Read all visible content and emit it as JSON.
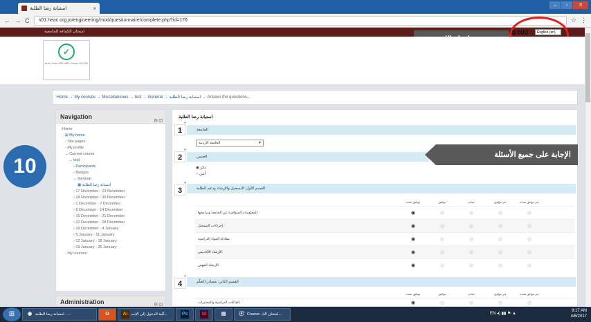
{
  "browser": {
    "tab_title": "استبانة رضا الطلبة",
    "tab_close": "×",
    "url": "n01.heac.org.jo/engineering/mod/questionnaire/complete.php?id=176",
    "nav_back": "←",
    "nav_forward": "→",
    "reload": "C",
    "star": "☆",
    "menu": "⋮"
  },
  "site": {
    "header_link": "امتحان الكفاءة الجامعية",
    "logout": "og out)",
    "language": "English (en)",
    "logo_text": "هيئة اعتماد مؤسسات التعليم العالي وضمان جودتها"
  },
  "annotations": {
    "language_callout": "تغيير اتجاه اللغة",
    "answer_callout": "الإجابة على جميع الأسئلة",
    "step_number": "10"
  },
  "breadcrumb": {
    "items": [
      "Home",
      "My courses",
      "Miscellaneous",
      "test",
      "General",
      "استبانة رضا الطلبة",
      "Answer the questions..."
    ],
    "separator": "→"
  },
  "navigation": {
    "title": "Navigation",
    "items": [
      "Home",
      "My home",
      "Site pages",
      "My profile",
      "Current course",
      "test",
      "Participants",
      "Badges",
      "General",
      "استبانة رضا الطلبة",
      "17 November - 23 November",
      "24 November - 30 November",
      "1 December - 7 December",
      "8 December - 14 December",
      "15 December - 21 December",
      "22 December - 28 December",
      "29 December - 4 January",
      "5 January - 11 January",
      "12 January - 18 January",
      "19 January - 25 January",
      "My courses"
    ]
  },
  "administration": {
    "title": "Administration"
  },
  "questionnaire": {
    "title": "استبانة رضا الطلبة",
    "q1": {
      "number": "1",
      "label": "الجامعة",
      "selected": "الجامعة الأردنية"
    },
    "q2": {
      "number": "2",
      "label": "الجنس",
      "options": [
        "ذكر",
        "أنثى"
      ]
    },
    "q3": {
      "number": "3",
      "label": "القسم الأول: التسجيل والإرشاد ودعم الطلبة",
      "columns": [
        "",
        "موافق بشدة",
        "موافق",
        "محايد",
        "غير موافق",
        "غير موافق بشدة"
      ],
      "rows": [
        "المعلومات المتوافرة عن الجامعة وبرامجها.",
        "إجراءات التسجيل.",
        "معادلة المواد الدراسية.",
        "الإرشاد الأكاديمي.",
        "الإرشاد المهني."
      ]
    },
    "q4": {
      "number": "4",
      "label": "القسم الثاني: مصادر التعلّم",
      "columns": [
        "",
        "موافق بشدة",
        "موافق",
        "محايد",
        "غير موافق",
        "غير موافق بشدة"
      ],
      "rows": [
        "القاعات الدراسية والمختبرات."
      ]
    }
  },
  "taskbar": {
    "items": [
      "استبانة رضا الطلبة - ...",
      "آلية الدخول إلى الإنت...",
      "Course: امتحان الك..."
    ],
    "icons": {
      "office": "O",
      "illustrator": "Ai",
      "photoshop": "Ps",
      "indesign": "Id"
    },
    "lang": "EN",
    "time": "9:17 AM",
    "date": "4/6/2017"
  }
}
